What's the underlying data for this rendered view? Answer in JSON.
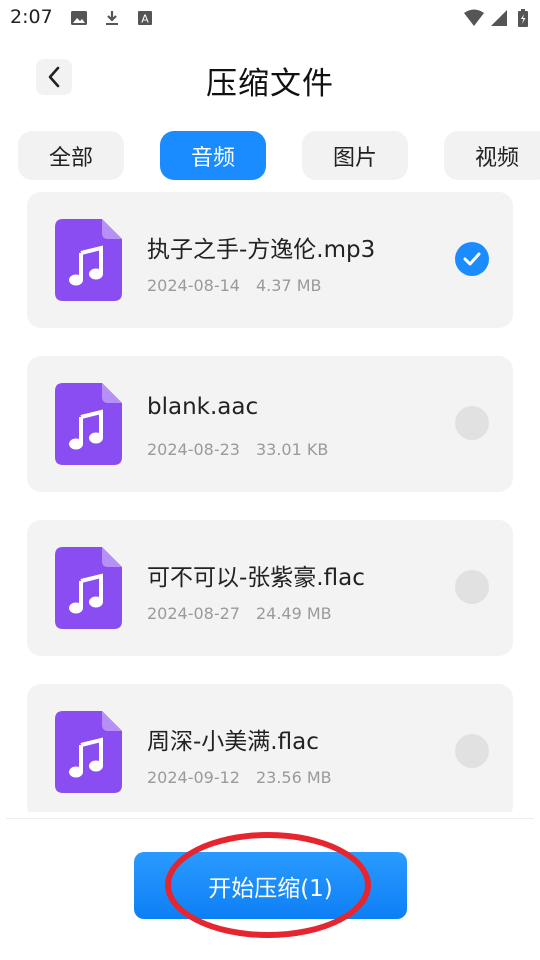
{
  "status_bar": {
    "time": "2:07",
    "left_icons": [
      "image-icon",
      "download-icon",
      "app-a-icon"
    ],
    "right_icons": [
      "wifi-icon",
      "cellular-signal-icon",
      "battery-icon"
    ]
  },
  "header": {
    "title": "压缩文件",
    "back_icon": "chevron-left-icon"
  },
  "tabs": [
    {
      "label": "全部",
      "active": false
    },
    {
      "label": "音频",
      "active": true
    },
    {
      "label": "图片",
      "active": false
    },
    {
      "label": "视频",
      "active": false
    }
  ],
  "files": [
    {
      "name": "执子之手-方逸伦.mp3",
      "date": "2024-08-14",
      "size": "4.37 MB",
      "selected": true
    },
    {
      "name": "blank.aac",
      "date": "2024-08-23",
      "size": "33.01 KB",
      "selected": false
    },
    {
      "name": "可不可以-张紫豪.flac",
      "date": "2024-08-27",
      "size": "24.49 MB",
      "selected": false
    },
    {
      "name": "周深-小美满.flac",
      "date": "2024-09-12",
      "size": "23.56 MB",
      "selected": false
    }
  ],
  "action": {
    "start_label": "开始压缩(1)"
  },
  "colors": {
    "accent": "#1a8cff",
    "file_icon": "#8a4df2",
    "highlight": "#e5262e",
    "card_bg": "#f3f3f3"
  }
}
